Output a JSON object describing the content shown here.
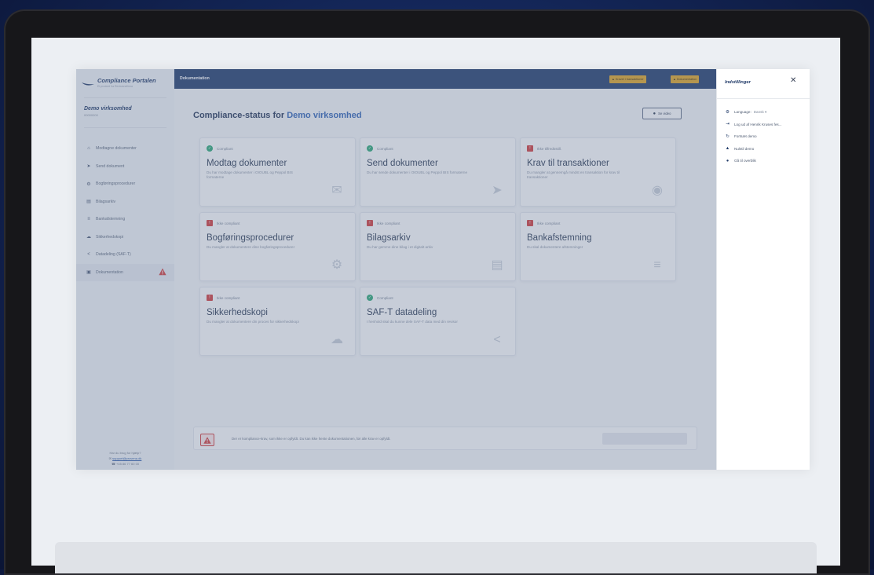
{
  "app": {
    "logo_name": "Compliance Portalen",
    "logo_tagline": "Et produkt fra Revisionsfirma",
    "company_name": "Demo virksomhed",
    "company_cvr": "00000000"
  },
  "sidebar": {
    "items": [
      {
        "label": "Modtagne dokumenter",
        "icon": "inbox-icon",
        "glyph": "⌂"
      },
      {
        "label": "Send dokument",
        "icon": "send-icon",
        "glyph": "➤"
      },
      {
        "label": "Bogføringsprocedurer",
        "icon": "gear-icon",
        "glyph": "⚙"
      },
      {
        "label": "Bilagsarkiv",
        "icon": "archive-icon",
        "glyph": "▤"
      },
      {
        "label": "Bankafstemning",
        "icon": "list-icon",
        "glyph": "≡"
      },
      {
        "label": "Sikkerhedskopi",
        "icon": "cloud-icon",
        "glyph": "☁"
      },
      {
        "label": "Datadeling (SAF-T)",
        "icon": "share-icon",
        "glyph": "<"
      },
      {
        "label": "Dokumentation",
        "icon": "document-icon",
        "glyph": "▣"
      }
    ],
    "support_question": "Har du brug for hjælp?",
    "support_email": "support@provena.dk",
    "support_phone": "+45 86 77 60 00"
  },
  "topbar": {
    "title": "Dokumentation",
    "btn1": "▲ Kravet i transaktioner",
    "btn2": "▲ Dokumentation"
  },
  "main": {
    "title_prefix": "Compliance-status for",
    "title_company": "Demo virksomhed",
    "video_button": "Se video",
    "cards": [
      {
        "status": "Compliant",
        "ok": true,
        "title": "Modtag dokumenter",
        "desc": "Du har modtage dokumenter i OIOUBL og Peppol BIS formaterne",
        "icon": "✉"
      },
      {
        "status": "Compliant",
        "ok": true,
        "title": "Send dokumenter",
        "desc": "Du har sende dokumenter i OIOUBL og Peppol BIS formaterne",
        "icon": "➤"
      },
      {
        "status": "Ikke tilfredsstill.",
        "ok": false,
        "title": "Krav til transaktioner",
        "desc": "Du mangler at gennemgå mindst en transaktion for krav til transaktioner",
        "icon": "◉"
      },
      {
        "status": "Ikke compliant",
        "ok": false,
        "title": "Bogføringsprocedurer",
        "desc": "Du mangler at dokumentere dine bogføringsprocedurer",
        "icon": "⚙"
      },
      {
        "status": "Ikke compliant",
        "ok": false,
        "title": "Bilagsarkiv",
        "desc": "Du har gemme dine bilag i et digitalt arkiv",
        "icon": "▤"
      },
      {
        "status": "Ikke compliant",
        "ok": false,
        "title": "Bankafstemning",
        "desc": "Du skal dokumentere afstemninger",
        "icon": "≡"
      },
      {
        "status": "Ikke compliant",
        "ok": false,
        "title": "Sikkerhedskopi",
        "desc": "Du mangler at dokumentere din proces for sikkerhedskopi",
        "icon": "☁"
      },
      {
        "status": "Compliant",
        "ok": true,
        "title": "SAF-T datadeling",
        "desc": "I henhold skal du kunne dele SAF-T data med din revisor",
        "icon": "<"
      }
    ],
    "alert_message": "Der er kompliance-krav, som ikke er opfyldt. Du kan ikke hente dokumentationen, før alle krav er opfyldt."
  },
  "panel": {
    "title": "Indstillinger",
    "close_glyph": "✕",
    "language_label": "Language:",
    "language_value": "Dansk ▾",
    "logout": "Log ud af Henrik Kruses fes...",
    "continue_demo": "Fortsæt demo",
    "reset_demo": "Nulstil demo",
    "overview": "Gå til overblik"
  },
  "colors": {
    "brand_navy": "#1f3a6b",
    "accent_blue": "#2f63b7",
    "compliant_green": "#2aa876",
    "warning_red": "#d33a3a",
    "topbar_button_amber": "#e2a623"
  }
}
